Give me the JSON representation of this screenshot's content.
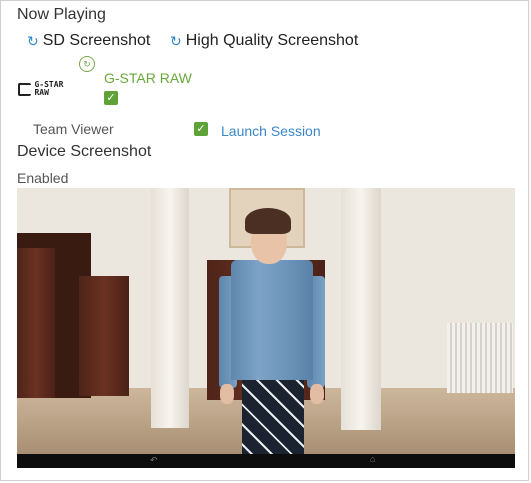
{
  "header": {
    "title": "Now Playing"
  },
  "screenshot_actions": {
    "sd_label": "SD Screenshot",
    "hq_label": "High Quality Screenshot"
  },
  "app": {
    "logo_text": "G-STAR RAW",
    "name": "G-STAR RAW",
    "checked": true
  },
  "remote": {
    "label": "Team Viewer",
    "checked": true,
    "launch_label": "Launch Session"
  },
  "device": {
    "heading": "Device Screenshot",
    "status": "Enabled"
  },
  "icons": {
    "refresh": "refresh-icon",
    "timer": "timer-icon",
    "check": "checkmark-icon",
    "back": "back-arrow-icon",
    "home": "home-icon"
  },
  "colors": {
    "accent_blue": "#2f88c7",
    "brand_green": "#6aa83b",
    "check_green": "#5fa237",
    "link_blue": "#3a87c9"
  }
}
